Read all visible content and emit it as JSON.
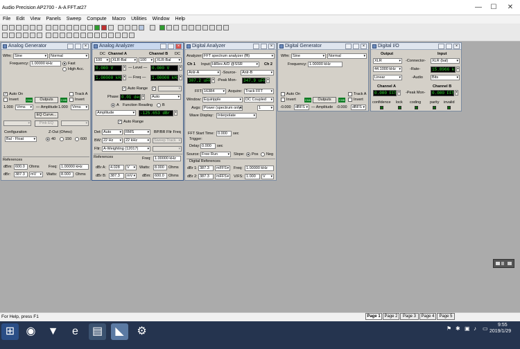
{
  "app": {
    "title": "Audio Precision AP2700 - A-A FFT.at27",
    "min": "—",
    "max": "☐",
    "close": "✕"
  },
  "menu": [
    "File",
    "Edit",
    "View",
    "Panels",
    "Sweep",
    "Compute",
    "Macro",
    "Utilities",
    "Window",
    "Help"
  ],
  "ag": {
    "title": "Analog Generator",
    "wfm_label": "Wfm:",
    "wfm": "Sine",
    "wfm_mode": "Normal",
    "freq_label": "Frequency:",
    "freq": "1.00000 kHz",
    "fast": "Fast",
    "high_acc": "High Acc.",
    "auto_on": "Auto On",
    "invert": "Invert",
    "outputs": "Outputs",
    "track_a": "Track A",
    "ch_a": "CHA",
    "ch_b": "CHB",
    "amp_a": "1.000",
    "unit_a": "Vrms",
    "amp_label": "— Amplitude",
    "amp_b": "1.000",
    "unit_b": "Vrms",
    "eq": "EQ Curve...",
    "pinkeq": "Pink EQ",
    "config_label": "Configuration",
    "config": "Bal - Float",
    "zout_label": "Z-Out (Ohms)",
    "zout": [
      "40",
      "150",
      "600"
    ],
    "references": "References",
    "dbm_label": "dBm:",
    "dbm": "600.0",
    "dbm_unit": "Ohms",
    "ref_freq_label": "Freq:",
    "ref_freq": "1.00000 kHz",
    "dbr_label": "dBr:",
    "dbr": "387.3",
    "dbr_unit": "mV",
    "watts_label": "Watts:",
    "watts": "8.000",
    "watts_unit": "Ohms"
  },
  "aa": {
    "title": "Analog Analyzer",
    "dc": "DC",
    "ch_a": "Channel A",
    "ch_b": "Channel B",
    "range_a": "100",
    "input_a": "XLR-Bal",
    "range_b": "100",
    "input_b": "XLR-Bal",
    "level_a": "0.000   V",
    "level_b": "0.000   V",
    "level_label": "— Level —",
    "freq_a": "1.00000 kHz",
    "freq_b": "1.00000 kHz",
    "freq_label": "— Freq —",
    "auto_range": "Auto Range",
    "phase_label": "Phase:",
    "phase": "0.01 deg",
    "phase_mode": "Auto",
    "func_reading": "Function Reading",
    "sel_a": "A",
    "sel_b": "B",
    "func": "Amplitude",
    "func_val": "-125.653 dBr A",
    "auto_range2": "Auto Range",
    "det_label": "Det:",
    "det": "Auto",
    "det_mode": "RMS",
    "bpbr": "BP/BR Fltr Freq",
    "bw_label": "BW:",
    "bw_lo": "22 Hz",
    "bw_hi": "22 kHz",
    "sweep_track": "Sweep Track",
    "fltr_label": "Fltr:",
    "fltr": "A-Weighting (12017)",
    "references": "References",
    "ref_freq_label": "Freq:",
    "ref_freq": "1.00000 kHz",
    "dbra_label": "dBr A:",
    "dbra": "4.028",
    "dbra_unit": "V",
    "watts_label": "Watts:",
    "watts": "8.000",
    "watts_unit": "Ohms",
    "dbrb_label": "dBr B:",
    "dbrb": "387.3",
    "dbrb_unit": "mV",
    "dbm_label": "dBm:",
    "dbm": "600.0",
    "dbm_unit": "Ohms"
  },
  "da": {
    "title": "Digital Analyzer",
    "analyzer_label": "Analyzer:",
    "analyzer": "FFT spectrum analyzer (fft)",
    "ch1": "Ch 1",
    "input_label": "Input:",
    "input": "HiRes A/D @SSR",
    "ch2": "Ch 2",
    "src_a": "Anlr-A",
    "source_label": "-Source-",
    "src_b": "Anlr-B",
    "peak_a": "307.2 uFFS",
    "peak_label": "-Peak Mon-",
    "peak_b": "347.9 uFFS",
    "fft_label": "FFT:",
    "fft": "16384",
    "acquire_label": "Acquire:",
    "acquire": "Track FFT",
    "window_label": "Window:",
    "window": "Equiripple",
    "coupling": "DC Coupled",
    "avgs_label": "Avgs:",
    "avgs": "Power (spectrum only)",
    "avgs_n": "1",
    "wave_label": "Wave Display:",
    "wave": "Interpolate",
    "start_label": "FFT Start Time:",
    "start": "0.000",
    "start_unit": "sec",
    "trigger": "Trigger:",
    "delay_label": "Delay:",
    "delay": "0.000",
    "delay_unit": "sec",
    "tsource_label": "Source:",
    "tsource": "Free Run",
    "slope_label": "Slope:",
    "pos": "Pos",
    "neg": "Neg",
    "dref": "Digital References",
    "dbr1_label": "dBr 1:",
    "dbr1": "387.3",
    "dbr1_unit": "mFFS",
    "freq_label": "Freq:",
    "freq": "1.00000 kHz",
    "dbr2_label": "dBr 2:",
    "dbr2": "387.3",
    "dbr2_unit": "mFFS",
    "vfs_label": "V/FS:",
    "vfs": "1.000",
    "vfs_unit": "V"
  },
  "dg": {
    "title": "Digital Generator",
    "wfm_label": "Wfm:",
    "wfm": "Sine",
    "wfm_mode": "Normal",
    "freq_label": "Frequency:",
    "freq": "1.00000 kHz",
    "auto_on": "Auto On",
    "invert": "Invert",
    "outputs": "Outputs",
    "track_a": "Track A",
    "ch_a": "CHA",
    "ch_b": "CHB",
    "amp_a": "-0.000",
    "unit_a": "dBFS",
    "amp_label": "— Amplitude",
    "amp_b": "-0.000",
    "unit_b": "dBFS"
  },
  "dio": {
    "title": "Digital I/O",
    "output_label": "Output",
    "input_label": "Input",
    "out_conn": "XLR",
    "conn_label": "-Connector-",
    "in_conn": "XLR (bal)",
    "out_rate": "44.1000 kHz",
    "rate_label": "-Rate-",
    "in_rate": "15.8966 kHz",
    "out_fmt": "Linear",
    "audio_label": "-Audio",
    "in_fmt": "Bits",
    "cha": "Channel A",
    "chb": "Channel B",
    "peak_a": "0.000 FFS",
    "peak_label": "-Peak Mon-",
    "peak_b": "0.000 FFS",
    "status": [
      "confidence",
      "lock",
      "coding",
      "parity",
      "invalid"
    ]
  },
  "status": {
    "help": "For Help, press F1",
    "pages": [
      "Page 1",
      "Page 2",
      "Page 3",
      "Page 4",
      "Page 5"
    ]
  },
  "taskbar": {
    "time": "9:55",
    "date": "2019/1/29",
    "start_icon": "windows-start-icon",
    "tray": [
      "flag-icon",
      "bluetooth-icon",
      "network-icon",
      "volume-icon",
      "notification-icon"
    ]
  }
}
